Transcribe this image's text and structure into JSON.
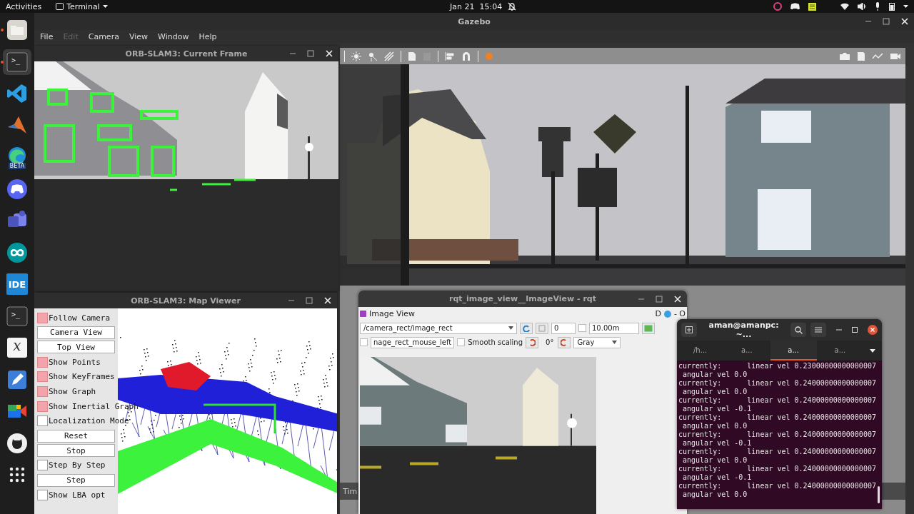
{
  "top_bar": {
    "activities": "Activities",
    "app_menu": "Terminal",
    "date": "Jan 21",
    "time": "15:04"
  },
  "dock": [
    {
      "kind": "files",
      "running": true,
      "selected": false
    },
    {
      "kind": "terminal",
      "label": ">_",
      "running": true,
      "selected": true
    },
    {
      "kind": "code",
      "running": false,
      "selected": false
    },
    {
      "kind": "cone",
      "running": false,
      "selected": false
    },
    {
      "kind": "browser",
      "label": "BETA",
      "running": false,
      "selected": false
    },
    {
      "kind": "gamepad",
      "running": false,
      "selected": false
    },
    {
      "kind": "chat",
      "running": false,
      "selected": false
    },
    {
      "kind": "infinity",
      "running": false,
      "selected": false
    },
    {
      "kind": "ide",
      "label": "IDE",
      "running": false,
      "selected": false
    },
    {
      "kind": "terminal",
      "label": ">_",
      "running": false,
      "selected": false
    },
    {
      "kind": "letter",
      "label": "x",
      "running": false,
      "selected": false
    },
    {
      "kind": "pencil",
      "running": false,
      "selected": false
    },
    {
      "kind": "video",
      "running": false,
      "selected": false
    },
    {
      "kind": "cat",
      "running": false,
      "selected": false
    },
    {
      "kind": "grid",
      "running": false,
      "selected": false
    }
  ],
  "gazebo": {
    "title": "Gazebo",
    "menu": [
      {
        "label": "File",
        "disabled": false
      },
      {
        "label": "Edit",
        "disabled": true
      },
      {
        "label": "Camera",
        "disabled": false
      },
      {
        "label": "View",
        "disabled": false
      },
      {
        "label": "Window",
        "disabled": false
      },
      {
        "label": "Help",
        "disabled": false
      }
    ],
    "time_label": "Tim"
  },
  "current_frame": {
    "title": "ORB-SLAM3: Current Frame"
  },
  "map_viewer": {
    "title": "ORB-SLAM3: Map Viewer",
    "controls": [
      {
        "kind": "checkbox",
        "label": "Follow Camera",
        "checked": true
      },
      {
        "kind": "button",
        "label": "Camera View"
      },
      {
        "kind": "button",
        "label": "Top View"
      },
      {
        "kind": "checkbox",
        "label": "Show Points",
        "checked": true
      },
      {
        "kind": "checkbox",
        "label": "Show KeyFrames",
        "checked": true
      },
      {
        "kind": "checkbox",
        "label": "Show Graph",
        "checked": true
      },
      {
        "kind": "checkbox",
        "label": "Show Inertial Graph",
        "checked": true
      },
      {
        "kind": "checkbox",
        "label": "Localization Mode",
        "checked": false
      },
      {
        "kind": "button",
        "label": "Reset"
      },
      {
        "kind": "button",
        "label": "Stop"
      },
      {
        "kind": "checkbox",
        "label": "Step By Step",
        "checked": false
      },
      {
        "kind": "button",
        "label": "Step"
      },
      {
        "kind": "checkbox",
        "label": "Show LBA opt",
        "checked": false
      }
    ]
  },
  "rqt": {
    "title": "rqt_image_view__ImageView - rqt",
    "plugin_title": "Image View",
    "plugin_buttons": [
      "D",
      "- O"
    ],
    "topic": "/camera_rect/image_rect",
    "spin_value": "0",
    "duration_checked": false,
    "duration": "10.00m",
    "mouse_checked": false,
    "mouse_topic": "nage_rect_mouse_left",
    "smooth_checked": false,
    "smooth_label": "Smooth scaling",
    "rotation": "0°",
    "color_mode": "Gray"
  },
  "terminal": {
    "title": "aman@amanpc: ~...",
    "tabs": [
      {
        "label": "/h...",
        "selected": false
      },
      {
        "label": "a...",
        "selected": false
      },
      {
        "label": "a...",
        "selected": true
      },
      {
        "label": "a...",
        "selected": false
      }
    ],
    "lines": [
      "currently:      linear vel 0.23000000000000007",
      " angular vel 0.0",
      "currently:      linear vel 0.24000000000000007",
      " angular vel 0.0",
      "currently:      linear vel 0.24000000000000007",
      " angular vel -0.1",
      "currently:      linear vel 0.24000000000000007",
      " angular vel 0.0",
      "currently:      linear vel 0.24000000000000007",
      " angular vel -0.1",
      "currently:      linear vel 0.24000000000000007",
      " angular vel 0.0",
      "currently:      linear vel 0.24000000000000007",
      " angular vel -0.1",
      "currently:      linear vel 0.24000000000000007",
      " angular vel 0.0"
    ]
  }
}
